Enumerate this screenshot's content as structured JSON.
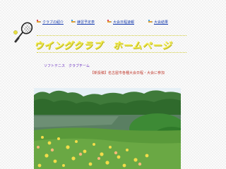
{
  "nav": [
    {
      "label": "クラブの紹介"
    },
    {
      "label": "練習予定表"
    },
    {
      "label": "大会日程速報"
    },
    {
      "label": "大会結果"
    }
  ],
  "header": {
    "title": "ウイングクラブ　ホームページ",
    "subtitle": "ソフトテニス　クラブチーム",
    "notice": "【新投稿】名古屋市各種大会日程・大会に参加"
  },
  "colors": {
    "title": "#f0ea4a",
    "link": "#1a3fb0",
    "subtitle": "#6a2fc0",
    "notice": "#c0382b"
  },
  "icons": [
    "tennis-racket-icon",
    "pencil-icon"
  ]
}
